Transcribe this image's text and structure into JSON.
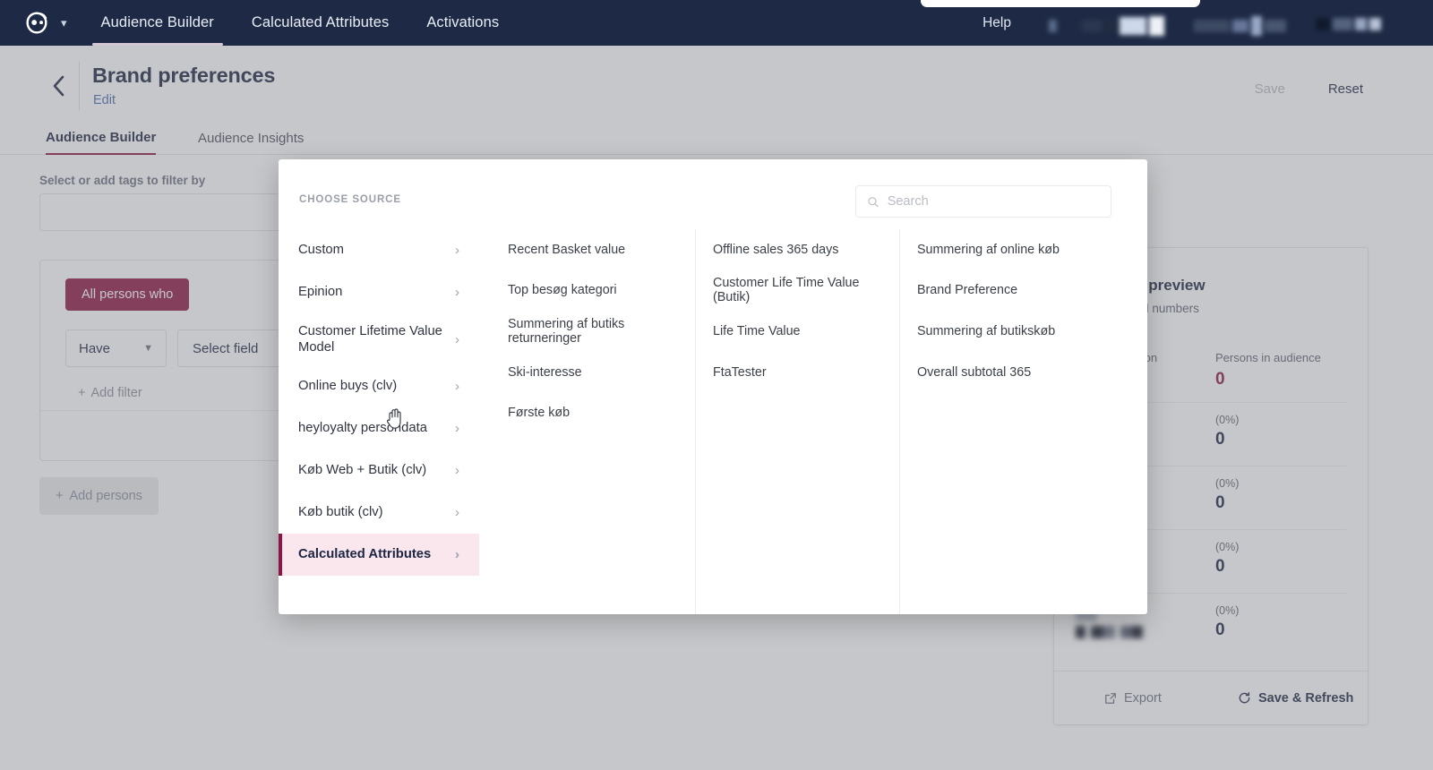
{
  "topnav": {
    "logo_icon": "owl-logo-icon",
    "caret_icon": "chevron-down-icon",
    "items": [
      {
        "label": "Audience Builder",
        "active": true
      },
      {
        "label": "Calculated Attributes",
        "active": false
      },
      {
        "label": "Activations",
        "active": false
      }
    ],
    "help_label": "Help",
    "redacted_blocks": 3,
    "background": "#1e2a45"
  },
  "header": {
    "back_icon": "chevron-left-icon",
    "title": "Brand preferences",
    "subtitle": "Edit",
    "save_label": "Save",
    "save_disabled": true,
    "reset_label": "Reset"
  },
  "tabs": [
    {
      "label": "Audience Builder",
      "active": true
    },
    {
      "label": "Audience Insights",
      "active": false
    }
  ],
  "builder": {
    "tags_label": "Select or add tags to filter by",
    "tags_value": "",
    "chip_all_persons": "All persons who",
    "operator_value": "Have",
    "operator_caret_icon": "chevron-down-icon",
    "field_placeholder": "Select field",
    "add_filter_label": "Add filter",
    "add_filter_icon": "plus-icon",
    "add_persons_label": "Add persons",
    "add_persons_icon": "plus-icon"
  },
  "preview": {
    "title": "Audience preview",
    "subtitle": "View updated numbers",
    "columns": [
      "Total population",
      "Persons in audience"
    ],
    "rows": [
      {
        "label": "Total population",
        "blurred": true,
        "pct": "",
        "value": "0",
        "accent": true,
        "header": "Persons in audience"
      },
      {
        "label": "",
        "blurred": true,
        "pct": "(0%)",
        "value": "0",
        "accent": false
      },
      {
        "label": "",
        "blurred": true,
        "pct": "(0%)",
        "value": "0",
        "accent": false
      },
      {
        "label": "",
        "blurred": true,
        "pct": "(0%)",
        "value": "0",
        "accent": false
      },
      {
        "label": "",
        "blurred": true,
        "pct": "(0%)",
        "value": "0",
        "accent": false
      }
    ],
    "export_label": "Export",
    "export_icon": "external-link-icon",
    "refresh_label": "Save & Refresh",
    "refresh_icon": "refresh-icon"
  },
  "modal": {
    "eyebrow": "CHOOSE SOURCE",
    "search_placeholder": "Search",
    "search_value": "",
    "search_icon": "search-icon",
    "chevron_icon": "chevron-right-icon",
    "sources": [
      {
        "label": "Custom",
        "selected": false,
        "tall": false
      },
      {
        "label": "Epinion",
        "selected": false,
        "tall": false
      },
      {
        "label": "Customer Lifetime Value Model",
        "selected": false,
        "tall": true
      },
      {
        "label": "Online buys (clv)",
        "selected": false,
        "tall": false
      },
      {
        "label": "heyloyalty persondata",
        "selected": false,
        "tall": false
      },
      {
        "label": "Køb Web + Butik (clv)",
        "selected": false,
        "tall": false
      },
      {
        "label": "Køb butik (clv)",
        "selected": false,
        "tall": false
      },
      {
        "label": "Calculated Attributes",
        "selected": true,
        "tall": false
      }
    ],
    "attribute_columns": [
      [
        "Recent Basket value",
        "Top besøg kategori",
        "Summering af butiks returneringer",
        "Ski-interesse",
        "Første køb"
      ],
      [
        "Offline sales 365 days",
        "Customer Life Time Value (Butik)",
        "Life Time Value",
        "FtaTester"
      ],
      [
        "Summering af online køb",
        "Brand Preference",
        "Summering af butikskøb",
        "Overall subtotal 365"
      ]
    ]
  },
  "colors": {
    "nav_bg": "#1e2a45",
    "accent": "#8c1543",
    "selected_bg": "#fae7ee",
    "scrim": "rgba(120,122,128,0.42)"
  }
}
